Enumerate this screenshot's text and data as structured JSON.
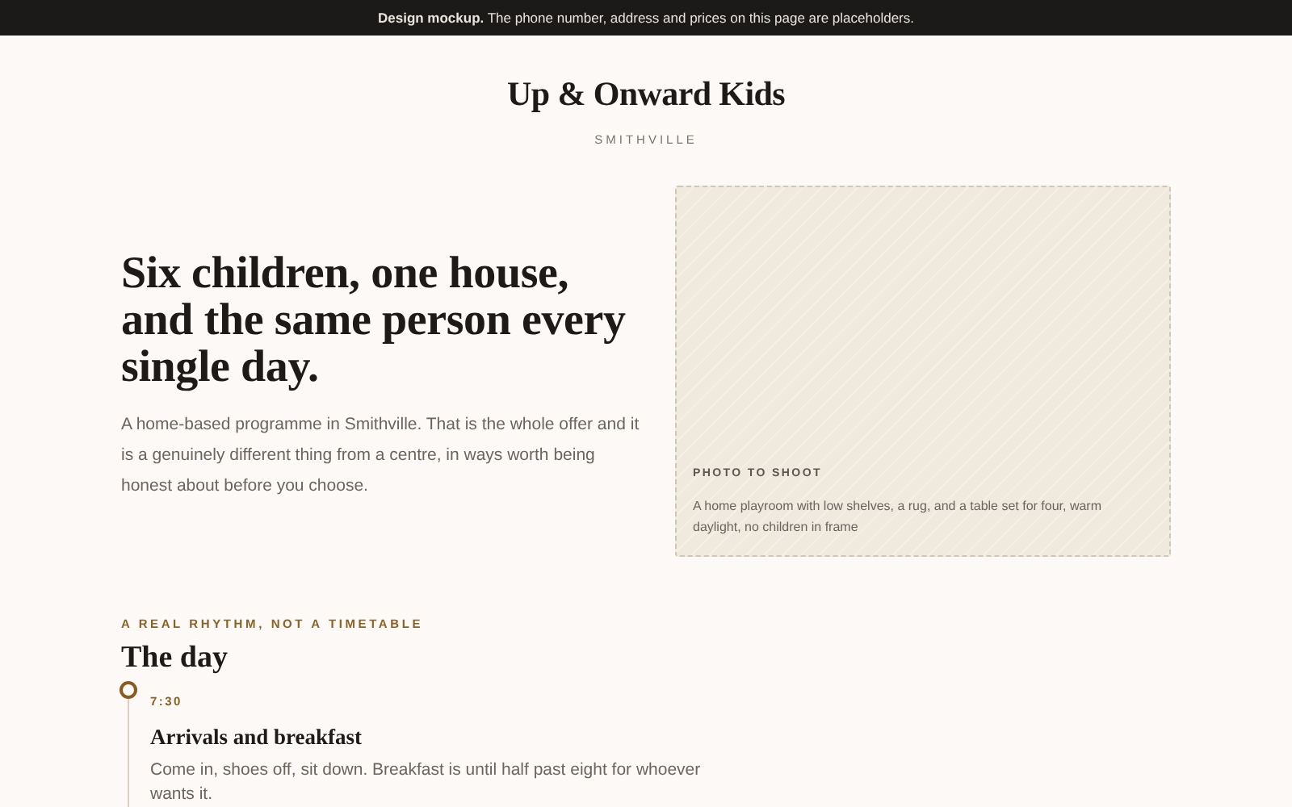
{
  "banner": {
    "text": "**Design mockup.** The phone number, address and prices on this page are placeholders."
  },
  "header": {
    "title": "Up & Onward Kids",
    "subtitle": "SMITHVILLE"
  },
  "hero": {
    "heading": "Six children, one house, and the same person every single day.",
    "intro": "A home-based programme in Smithville. That is the whole offer and it is a genuinely different thing from a centre, in ways worth being honest about before you choose.",
    "photo_placeholder": {
      "label": "PHOTO TO SHOOT",
      "description": "A home playroom with low shelves, a rug, and a table set for four, warm daylight, no children in frame"
    }
  },
  "day": {
    "eyebrow": "A REAL RHYTHM, NOT A TIMETABLE",
    "title": "The day",
    "events": [
      {
        "time": "7:30",
        "title": "Arrivals and breakfast",
        "description": "Come in, shoes off, sit down. Breakfast is until half past eight for whoever wants it."
      }
    ]
  }
}
